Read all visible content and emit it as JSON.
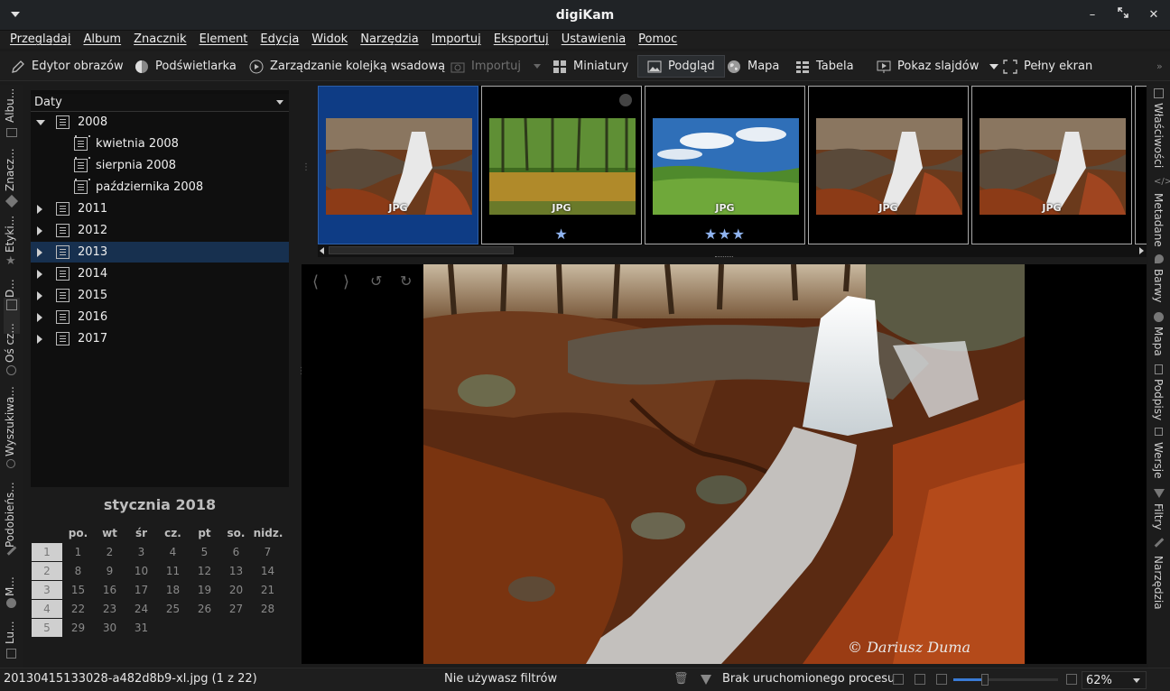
{
  "window": {
    "title": "digiKam"
  },
  "menu": [
    "Przeglądaj",
    "Album",
    "Znacznik",
    "Element",
    "Edycja",
    "Widok",
    "Narzędzia",
    "Importuj",
    "Eksportuj",
    "Ustawienia",
    "Pomoc"
  ],
  "toolbar": {
    "image_editor": "Edytor obrazów",
    "light_table": "Podświetlarka",
    "batch_queue": "Zarządzanie kolejką wsadową",
    "import": "Importuj",
    "thumbnails": "Miniatury",
    "preview": "Podgląd",
    "map": "Mapa",
    "table": "Tabela",
    "slideshow": "Pokaz slajdów",
    "fullscreen": "Pełny ekran"
  },
  "left_tabs": [
    "Albu...",
    "Znacz...",
    "Etyki...",
    "D...",
    "Oś cz...",
    "Wyszukiwa...",
    "Podobieńs...",
    "M...",
    "Lu..."
  ],
  "right_tabs": [
    "Właściwości",
    "Metadane",
    "Barwy",
    "Mapa",
    "Podpisy",
    "Wersje",
    "Filtry",
    "Narzędzia"
  ],
  "date_view": {
    "combo_label": "Daty",
    "tree": [
      {
        "label": "2008",
        "expanded": true,
        "level": 0
      },
      {
        "label": "kwietnia 2008",
        "level": 1
      },
      {
        "label": "sierpnia 2008",
        "level": 1
      },
      {
        "label": "października 2008",
        "level": 1
      },
      {
        "label": "2011",
        "level": 0
      },
      {
        "label": "2012",
        "level": 0
      },
      {
        "label": "2013",
        "level": 0,
        "selected": true
      },
      {
        "label": "2014",
        "level": 0
      },
      {
        "label": "2015",
        "level": 0
      },
      {
        "label": "2016",
        "level": 0
      },
      {
        "label": "2017",
        "level": 0
      }
    ]
  },
  "calendar": {
    "title": "stycznia 2018",
    "weekdays": [
      "po.",
      "wt",
      "śr",
      "cz.",
      "pt",
      "so.",
      "nidz."
    ],
    "weeks": [
      {
        "week": "1",
        "days": [
          "1",
          "2",
          "3",
          "4",
          "5",
          "6",
          "7"
        ]
      },
      {
        "week": "2",
        "days": [
          "8",
          "9",
          "10",
          "11",
          "12",
          "13",
          "14"
        ]
      },
      {
        "week": "3",
        "days": [
          "15",
          "16",
          "17",
          "18",
          "19",
          "20",
          "21"
        ]
      },
      {
        "week": "4",
        "days": [
          "22",
          "23",
          "24",
          "25",
          "26",
          "27",
          "28"
        ]
      },
      {
        "week": "5",
        "days": [
          "29",
          "30",
          "31"
        ]
      }
    ]
  },
  "thumbnails": [
    {
      "format": "JPG",
      "rating": 0,
      "selected": true,
      "scene": "waterfall"
    },
    {
      "format": "JPG",
      "rating": 1,
      "selected": false,
      "scene": "forest"
    },
    {
      "format": "JPG",
      "rating": 3,
      "selected": false,
      "scene": "landscape"
    },
    {
      "format": "JPG",
      "rating": 0,
      "selected": false,
      "scene": "waterfall"
    },
    {
      "format": "JPG",
      "rating": 0,
      "selected": false,
      "scene": "waterfall"
    }
  ],
  "preview": {
    "watermark": "© Dariusz Duma"
  },
  "status": {
    "filename": "20130415133028-a482d8b9-xl.jpg (1 z 22)",
    "filter": "Nie używasz filtrów",
    "process": "Brak uruchomionego procesu",
    "zoom": "62%",
    "zoom_level": 0.3
  },
  "colors": {
    "selection": "#17304f",
    "thumb_selection": "#0e3c85",
    "star": "#8fb3ef",
    "accent": "#3a7bd5"
  }
}
